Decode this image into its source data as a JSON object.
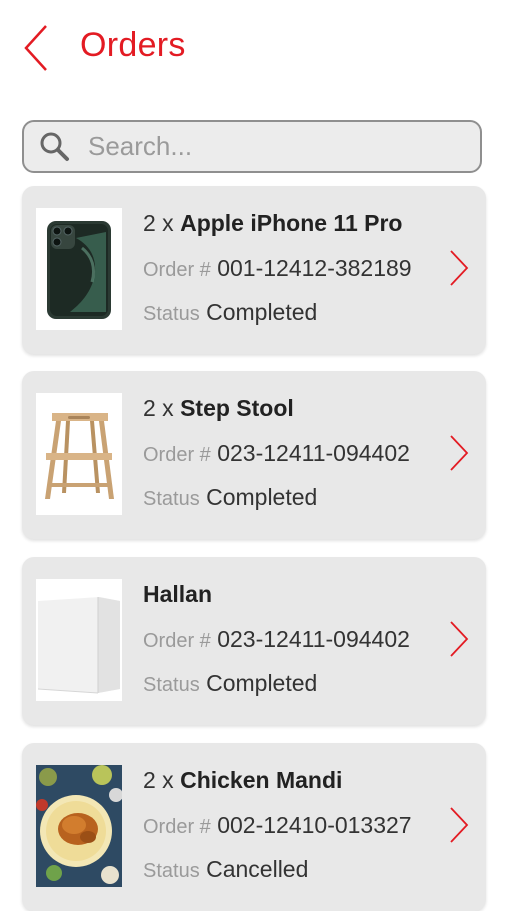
{
  "header": {
    "title": "Orders"
  },
  "search": {
    "placeholder": "Search..."
  },
  "labels": {
    "order": "Order #",
    "status": "Status"
  },
  "colors": {
    "accent": "#e31b23",
    "card": "#e8e8e8"
  },
  "orders": [
    {
      "quantity": "2 x",
      "name": "Apple iPhone 11 Pro",
      "order_number": "001-12412-382189",
      "status": "Completed",
      "thumbnail": "iphone"
    },
    {
      "quantity": "2 x",
      "name": "Step Stool",
      "order_number": "023-12411-094402",
      "status": "Completed",
      "thumbnail": "step-stool"
    },
    {
      "quantity": "",
      "name": "Hallan",
      "order_number": "023-12411-094402",
      "status": "Completed",
      "thumbnail": "white-cabinet"
    },
    {
      "quantity": "2 x",
      "name": "Chicken Mandi",
      "order_number": "002-12410-013327",
      "status": "Cancelled",
      "thumbnail": "chicken-dish"
    }
  ]
}
